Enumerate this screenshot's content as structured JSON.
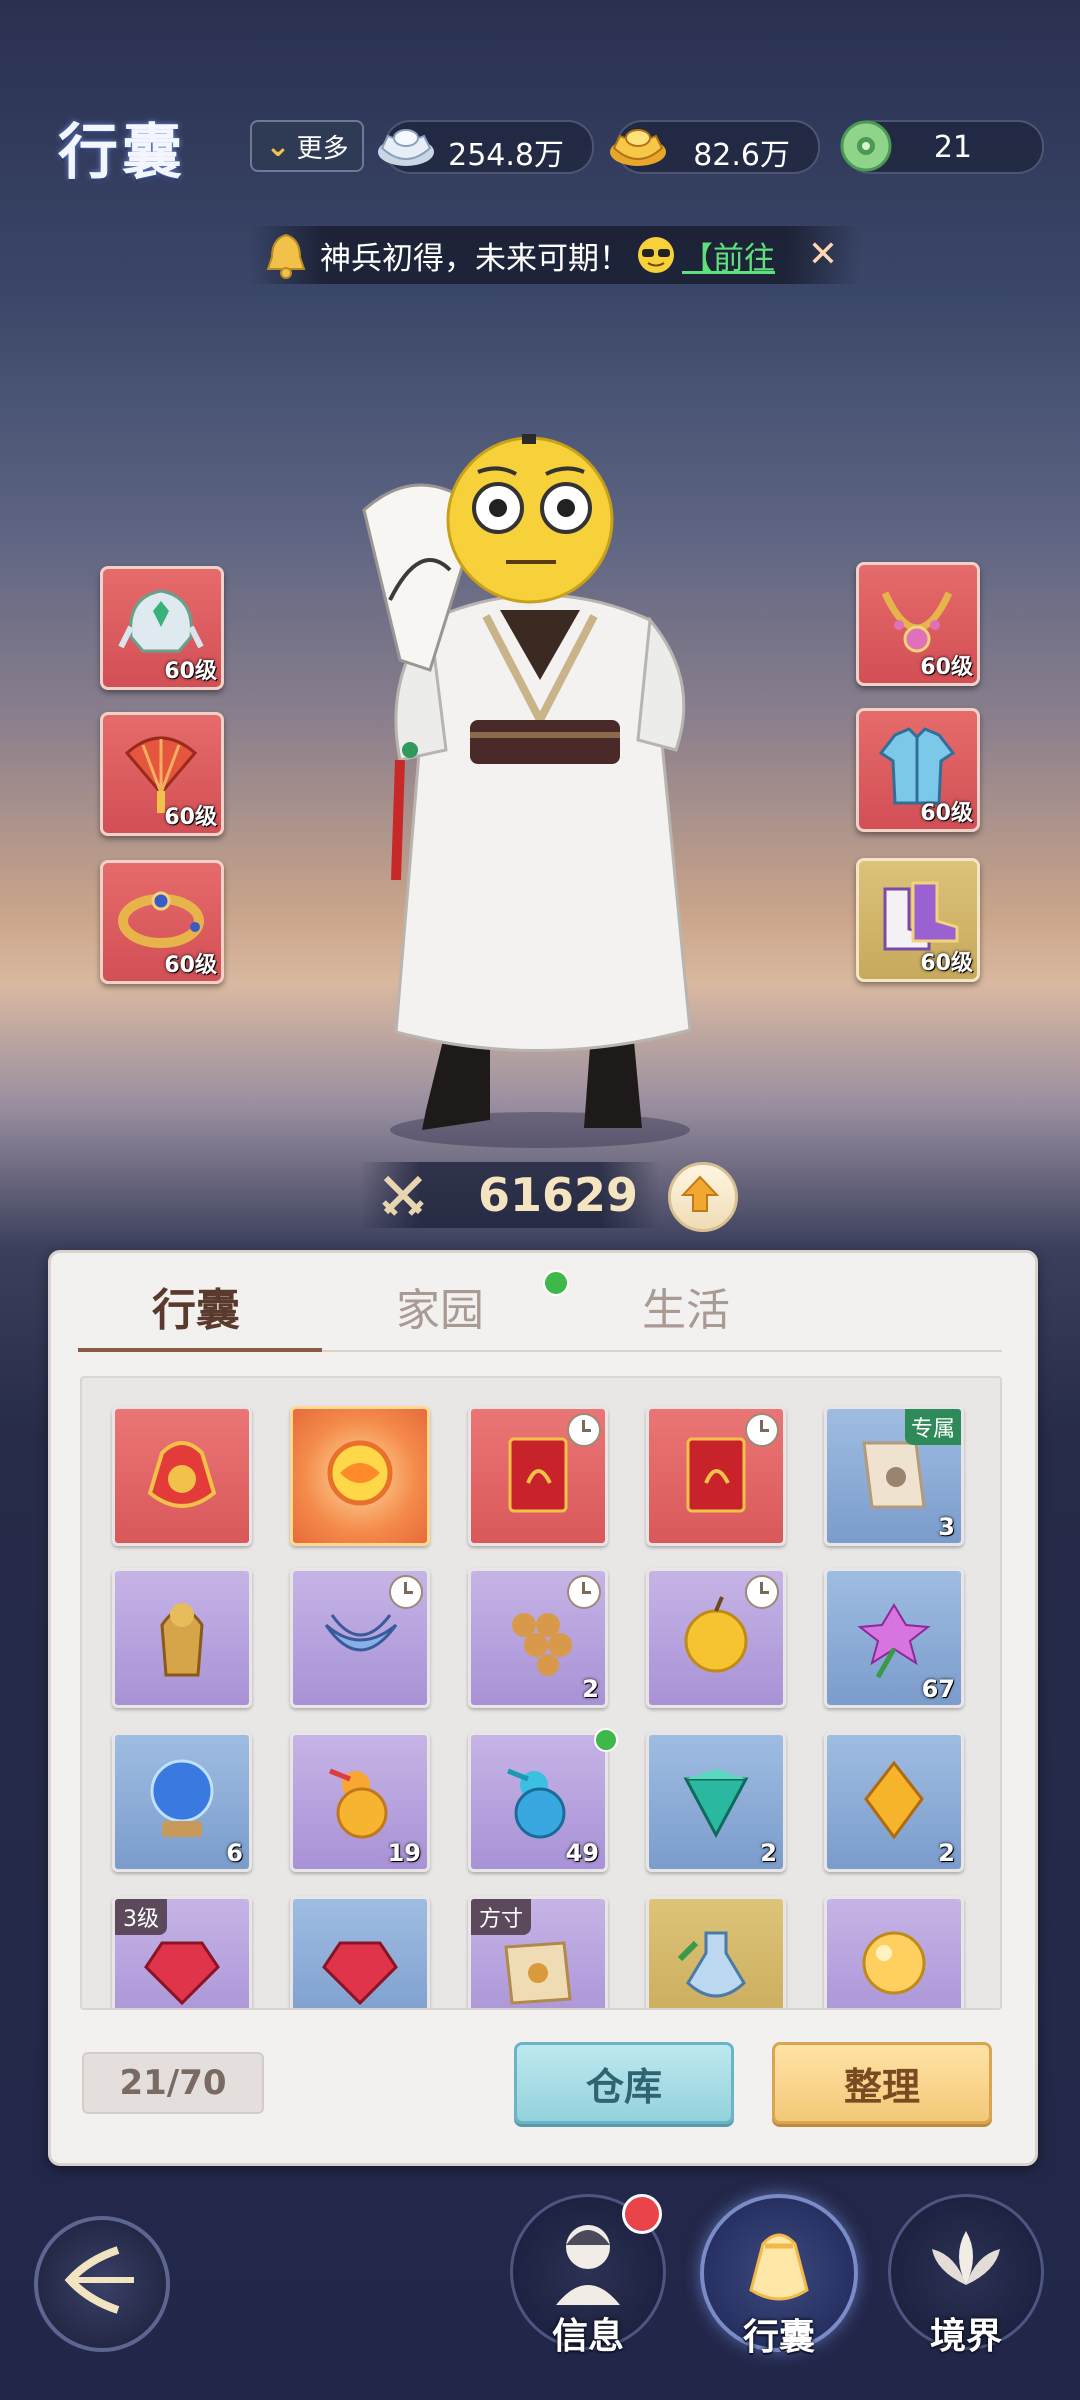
{
  "header": {
    "title": "行囊",
    "more_label": "更多",
    "currencies": [
      {
        "name": "silver-ingot-icon",
        "value": "254.8万"
      },
      {
        "name": "gold-ingot-icon",
        "value": "82.6万"
      },
      {
        "name": "jade-coin-icon",
        "value": "21"
      }
    ]
  },
  "notice": {
    "text": "神兵初得，未来可期！",
    "link": "【前往"
  },
  "equipment": {
    "left": [
      {
        "icon": "helmet-icon",
        "level": "60级",
        "quality": "red"
      },
      {
        "icon": "fan-weapon-icon",
        "level": "60级",
        "quality": "red"
      },
      {
        "icon": "bracelet-icon",
        "level": "60级",
        "quality": "red"
      }
    ],
    "right": [
      {
        "icon": "necklace-icon",
        "level": "60级",
        "quality": "red"
      },
      {
        "icon": "armor-icon",
        "level": "60级",
        "quality": "red"
      },
      {
        "icon": "boots-icon",
        "level": "60级",
        "quality": "gold"
      }
    ]
  },
  "power": {
    "value": "61629"
  },
  "tabs": [
    {
      "label": "行囊",
      "active": true
    },
    {
      "label": "家园",
      "active": false
    },
    {
      "label": "生活",
      "active": false
    }
  ],
  "items": [
    {
      "icon": "red-pouch-icon",
      "quality": "red",
      "count": "",
      "timed": false,
      "tag": ""
    },
    {
      "icon": "fire-orb-icon",
      "quality": "orange",
      "count": "",
      "timed": false,
      "tag": ""
    },
    {
      "icon": "red-envelope-icon",
      "quality": "red",
      "count": "",
      "timed": true,
      "tag": ""
    },
    {
      "icon": "red-envelope-icon",
      "quality": "red",
      "count": "",
      "timed": true,
      "tag": ""
    },
    {
      "icon": "scroll-icon",
      "quality": "blue",
      "count": "3",
      "timed": false,
      "tag_right": "专属"
    },
    {
      "icon": "golden-statue-icon",
      "quality": "purple",
      "count": "",
      "timed": false,
      "tag": ""
    },
    {
      "icon": "banana-icon",
      "quality": "purple",
      "count": "",
      "timed": true,
      "tag": ""
    },
    {
      "icon": "grapes-icon",
      "quality": "purple",
      "count": "2",
      "timed": true,
      "tag": ""
    },
    {
      "icon": "golden-apple-icon",
      "quality": "purple",
      "count": "",
      "timed": true,
      "tag": ""
    },
    {
      "icon": "flower-icon",
      "quality": "blue",
      "count": "67",
      "timed": false,
      "tag": ""
    },
    {
      "icon": "crystal-ball-icon",
      "quality": "blue",
      "count": "6",
      "timed": false,
      "tag": ""
    },
    {
      "icon": "orange-gourd-icon",
      "quality": "purple",
      "count": "19",
      "timed": false,
      "tag": ""
    },
    {
      "icon": "blue-gourd-icon",
      "quality": "purple",
      "count": "49",
      "timed": false,
      "tag": ""
    },
    {
      "icon": "green-gem-icon",
      "quality": "blue",
      "count": "2",
      "timed": false,
      "tag": ""
    },
    {
      "icon": "yellow-gem-icon",
      "quality": "blue",
      "count": "2",
      "timed": false,
      "tag": ""
    },
    {
      "icon": "red-gem-icon",
      "quality": "purple",
      "count": "",
      "timed": false,
      "tag": "3级"
    },
    {
      "icon": "red-gem-icon",
      "quality": "blue",
      "count": "",
      "timed": false,
      "tag": ""
    },
    {
      "icon": "map-scroll-icon",
      "quality": "purple",
      "count": "",
      "timed": false,
      "tag": "方寸"
    },
    {
      "icon": "potion-bottle-icon",
      "quality": "gold",
      "count": "",
      "timed": false,
      "tag": ""
    },
    {
      "icon": "golden-pearl-icon",
      "quality": "purple",
      "count": "",
      "timed": false,
      "tag": ""
    }
  ],
  "footer": {
    "capacity": "21/70",
    "store_label": "仓库",
    "sort_label": "整理"
  },
  "nav": [
    {
      "label": "信息",
      "icon": "character-portrait-icon"
    },
    {
      "label": "行囊",
      "icon": "bag-icon"
    },
    {
      "label": "境界",
      "icon": "lotus-icon"
    }
  ],
  "colors": {
    "active_tab": "#5a3a2c",
    "notice_link": "#5fe07a",
    "notification_dot": "#e8444a",
    "new_item_dot": "#3fb84a"
  }
}
